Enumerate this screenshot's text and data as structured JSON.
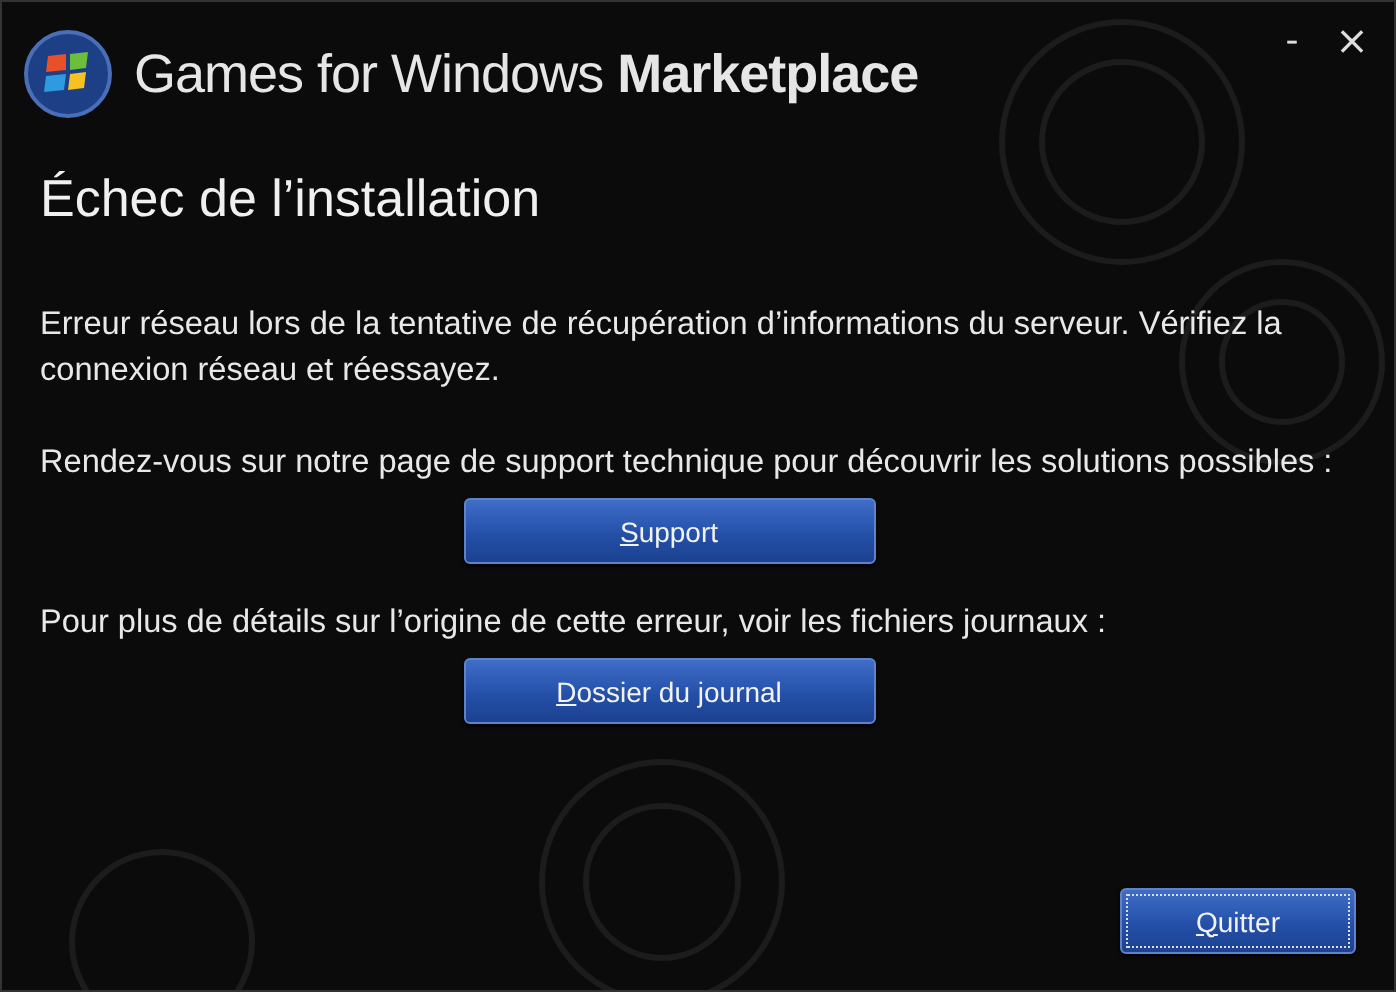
{
  "window": {
    "title": "Games for Windows **Marketplace**",
    "controls": [
      {
        "kind": "minimize",
        "label": "-"
      },
      {
        "kind": "close",
        "label": "×"
      }
    ]
  },
  "heading": "Échec de l’installation",
  "message": "Erreur réseau lors de la tentative de récupération d’informations du serveur. Vérifiez la connexion réseau et réessayez.",
  "sections": [
    {
      "text": "Rendez-vous sur notre page de support technique pour découvrir les solutions possibles :",
      "button": {
        "label": "Support",
        "focused": false
      }
    },
    {
      "text": "Pour plus de détails sur l’origine de cette erreur, voir les fichiers journaux :",
      "button": {
        "label": "Dossier du journal",
        "focused": false
      }
    }
  ],
  "footer_button": {
    "label": "Quitter",
    "focused": true
  }
}
